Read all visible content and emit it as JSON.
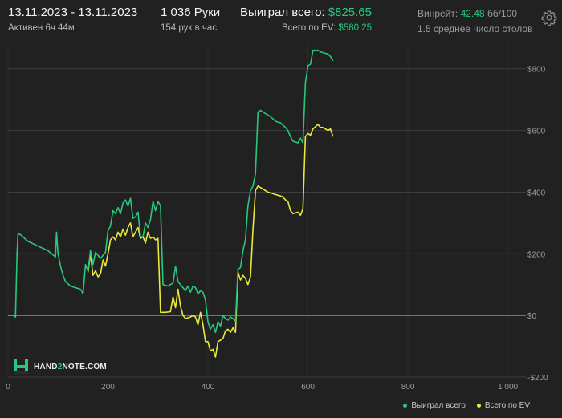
{
  "header": {
    "date_range": "13.11.2023 - 13.11.2023",
    "active": "Активен 6ч 44м",
    "hands": "1 036 Руки",
    "hands_per_hour": "154 рук в час",
    "won_label": "Выиграл всего:",
    "won_value": "$825.65",
    "ev_label": "Всего по EV:",
    "ev_value": "$580.25",
    "winrate_label": "Винрейт:",
    "winrate_value": "42.48",
    "winrate_unit": "бб/100",
    "tables": "1.5 среднее число столов",
    "settings_icon": "gear-icon"
  },
  "logo": {
    "part1": "HAND",
    "part2": "2",
    "part3": "NOTE.COM",
    "icon": "hand2note-logo-icon"
  },
  "colors": {
    "background": "#212121",
    "grid": "#3c3c3c",
    "won_series": "#27c87c",
    "ev_series": "#e8e83a",
    "accent": "#27c87c"
  },
  "chart_data": {
    "type": "line",
    "xlim": [
      0,
      1036
    ],
    "ylim": [
      -200,
      880
    ],
    "x_ticks": [
      0,
      200,
      400,
      600,
      800,
      1000
    ],
    "x_tick_labels": [
      "0",
      "200",
      "400",
      "600",
      "800",
      "1 000"
    ],
    "y_ticks": [
      800,
      600,
      400,
      200,
      0,
      -200
    ],
    "y_tick_labels": [
      "$800",
      "$600",
      "$400",
      "$200",
      "$0",
      "-$200"
    ],
    "grid": true,
    "legend_position": "bottom-right",
    "series": [
      {
        "name": "Выиграл всего",
        "color": "#27c87c",
        "points": [
          [
            0,
            0
          ],
          [
            10,
            0
          ],
          [
            15,
            -5
          ],
          [
            18,
            200
          ],
          [
            20,
            265
          ],
          [
            25,
            262
          ],
          [
            40,
            240
          ],
          [
            60,
            225
          ],
          [
            80,
            210
          ],
          [
            95,
            190
          ],
          [
            97,
            270
          ],
          [
            100,
            200
          ],
          [
            105,
            160
          ],
          [
            110,
            130
          ],
          [
            115,
            110
          ],
          [
            125,
            95
          ],
          [
            145,
            85
          ],
          [
            147,
            80
          ],
          [
            150,
            70
          ],
          [
            155,
            165
          ],
          [
            160,
            145
          ],
          [
            165,
            210
          ],
          [
            170,
            165
          ],
          [
            175,
            205
          ],
          [
            185,
            185
          ],
          [
            195,
            205
          ],
          [
            200,
            275
          ],
          [
            205,
            290
          ],
          [
            210,
            340
          ],
          [
            215,
            330
          ],
          [
            220,
            350
          ],
          [
            225,
            330
          ],
          [
            230,
            365
          ],
          [
            235,
            375
          ],
          [
            240,
            355
          ],
          [
            245,
            380
          ],
          [
            250,
            315
          ],
          [
            255,
            320
          ],
          [
            260,
            335
          ],
          [
            265,
            255
          ],
          [
            270,
            255
          ],
          [
            275,
            300
          ],
          [
            280,
            285
          ],
          [
            285,
            310
          ],
          [
            290,
            370
          ],
          [
            295,
            340
          ],
          [
            300,
            370
          ],
          [
            305,
            355
          ],
          [
            310,
            100
          ],
          [
            320,
            95
          ],
          [
            330,
            105
          ],
          [
            335,
            160
          ],
          [
            340,
            110
          ],
          [
            345,
            100
          ],
          [
            355,
            80
          ],
          [
            360,
            95
          ],
          [
            365,
            75
          ],
          [
            370,
            95
          ],
          [
            375,
            90
          ],
          [
            380,
            70
          ],
          [
            385,
            80
          ],
          [
            390,
            75
          ],
          [
            395,
            50
          ],
          [
            400,
            -20
          ],
          [
            405,
            -45
          ],
          [
            410,
            -30
          ],
          [
            415,
            -55
          ],
          [
            420,
            -20
          ],
          [
            425,
            -35
          ],
          [
            430,
            0
          ],
          [
            435,
            -10
          ],
          [
            440,
            -15
          ],
          [
            445,
            -5
          ],
          [
            450,
            -10
          ],
          [
            455,
            -20
          ],
          [
            460,
            150
          ],
          [
            465,
            155
          ],
          [
            470,
            210
          ],
          [
            475,
            245
          ],
          [
            480,
            355
          ],
          [
            485,
            405
          ],
          [
            490,
            420
          ],
          [
            495,
            460
          ],
          [
            500,
            660
          ],
          [
            505,
            665
          ],
          [
            515,
            655
          ],
          [
            525,
            645
          ],
          [
            535,
            630
          ],
          [
            545,
            625
          ],
          [
            555,
            610
          ],
          [
            560,
            600
          ],
          [
            565,
            580
          ],
          [
            570,
            565
          ],
          [
            580,
            560
          ],
          [
            585,
            575
          ],
          [
            590,
            560
          ],
          [
            595,
            755
          ],
          [
            600,
            810
          ],
          [
            605,
            815
          ],
          [
            610,
            860
          ],
          [
            620,
            860
          ],
          [
            625,
            855
          ],
          [
            635,
            850
          ],
          [
            640,
            848
          ],
          [
            645,
            840
          ],
          [
            650,
            826
          ]
        ]
      },
      {
        "name": "Всего по EV",
        "color": "#e8e83a",
        "points": [
          [
            160,
            140
          ],
          [
            165,
            200
          ],
          [
            170,
            130
          ],
          [
            175,
            145
          ],
          [
            180,
            125
          ],
          [
            185,
            135
          ],
          [
            190,
            180
          ],
          [
            195,
            160
          ],
          [
            200,
            200
          ],
          [
            205,
            245
          ],
          [
            210,
            255
          ],
          [
            215,
            245
          ],
          [
            220,
            270
          ],
          [
            225,
            255
          ],
          [
            230,
            280
          ],
          [
            235,
            260
          ],
          [
            240,
            285
          ],
          [
            245,
            300
          ],
          [
            250,
            255
          ],
          [
            255,
            270
          ],
          [
            260,
            285
          ],
          [
            265,
            250
          ],
          [
            270,
            255
          ],
          [
            275,
            235
          ],
          [
            280,
            270
          ],
          [
            285,
            250
          ],
          [
            290,
            255
          ],
          [
            295,
            245
          ],
          [
            300,
            250
          ],
          [
            305,
            10
          ],
          [
            315,
            10
          ],
          [
            325,
            12
          ],
          [
            330,
            60
          ],
          [
            335,
            25
          ],
          [
            340,
            85
          ],
          [
            345,
            30
          ],
          [
            350,
            0
          ],
          [
            355,
            -10
          ],
          [
            365,
            -5
          ],
          [
            370,
            0
          ],
          [
            375,
            -5
          ],
          [
            380,
            -30
          ],
          [
            385,
            10
          ],
          [
            390,
            -30
          ],
          [
            395,
            -85
          ],
          [
            400,
            -85
          ],
          [
            405,
            -115
          ],
          [
            410,
            -110
          ],
          [
            415,
            -135
          ],
          [
            420,
            -85
          ],
          [
            425,
            -80
          ],
          [
            430,
            -75
          ],
          [
            435,
            -50
          ],
          [
            440,
            -45
          ],
          [
            445,
            -55
          ],
          [
            450,
            -40
          ],
          [
            455,
            -55
          ],
          [
            460,
            140
          ],
          [
            465,
            115
          ],
          [
            470,
            130
          ],
          [
            475,
            120
          ],
          [
            480,
            100
          ],
          [
            485,
            125
          ],
          [
            490,
            280
          ],
          [
            495,
            405
          ],
          [
            500,
            420
          ],
          [
            510,
            410
          ],
          [
            520,
            400
          ],
          [
            530,
            395
          ],
          [
            540,
            390
          ],
          [
            550,
            385
          ],
          [
            555,
            375
          ],
          [
            560,
            370
          ],
          [
            565,
            340
          ],
          [
            570,
            330
          ],
          [
            580,
            335
          ],
          [
            585,
            325
          ],
          [
            590,
            345
          ],
          [
            595,
            580
          ],
          [
            600,
            590
          ],
          [
            605,
            585
          ],
          [
            610,
            605
          ],
          [
            620,
            620
          ],
          [
            625,
            610
          ],
          [
            630,
            610
          ],
          [
            640,
            600
          ],
          [
            645,
            605
          ],
          [
            650,
            580
          ]
        ]
      }
    ]
  }
}
